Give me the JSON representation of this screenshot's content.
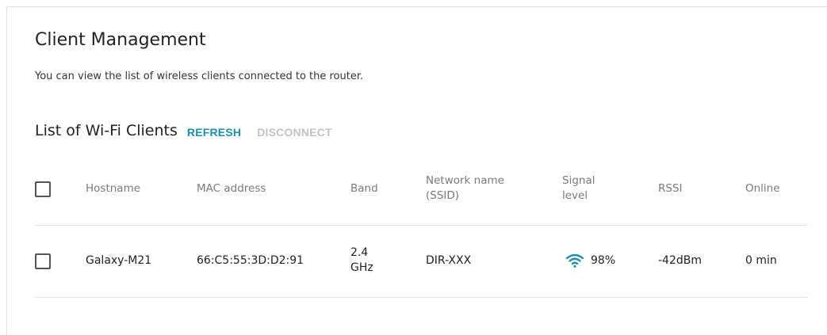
{
  "page": {
    "title": "Client Management",
    "description": "You can view the list of wireless clients connected to the router."
  },
  "list": {
    "title": "List of Wi-Fi Clients",
    "actions": {
      "refresh": "REFRESH",
      "disconnect": "DISCONNECT"
    }
  },
  "table": {
    "columns": {
      "hostname": "Hostname",
      "mac": "MAC address",
      "band": "Band",
      "ssid_line1": "Network name",
      "ssid_line2": "(SSID)",
      "signal_line1": "Signal",
      "signal_line2": "level",
      "rssi": "RSSI",
      "online": "Online"
    },
    "rows": [
      {
        "hostname": "Galaxy-M21",
        "mac": "66:C5:55:3D:D2:91",
        "band_line1": "2.4",
        "band_line2": "GHz",
        "ssid": "DIR-XXX",
        "signal_icon": "wifi-icon",
        "signal": "98%",
        "rssi": "-42dBm",
        "online": "0 min"
      }
    ]
  },
  "colors": {
    "accent": "#1a8fab",
    "disabled": "#c3c3c3",
    "header_text": "#7a7a7a"
  }
}
